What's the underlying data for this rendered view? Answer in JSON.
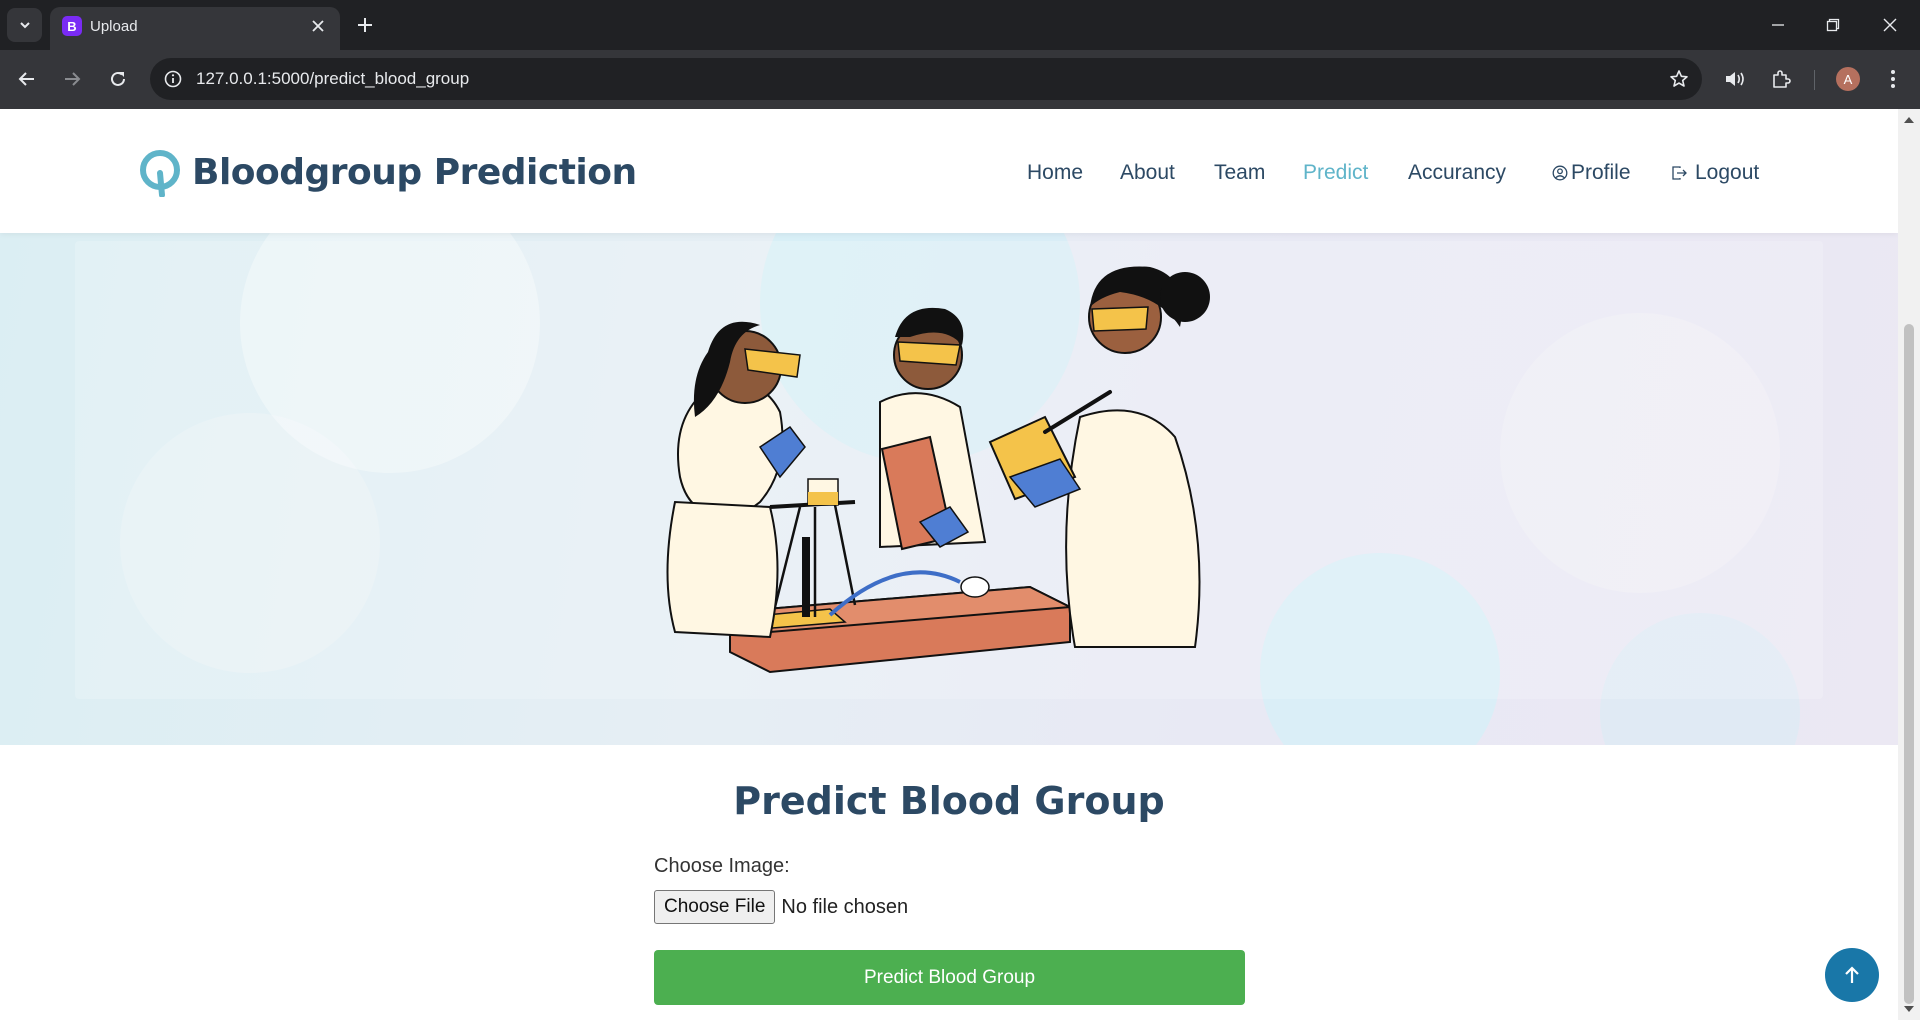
{
  "browser": {
    "tab_title": "Upload",
    "tab_favicon_letter": "B",
    "url": "127.0.0.1:5000/predict_blood_group",
    "profile_initial": "A"
  },
  "site": {
    "brand": "Bloodgroup Prediction",
    "nav": [
      {
        "label": "Home",
        "active": false
      },
      {
        "label": "About",
        "active": false
      },
      {
        "label": "Team",
        "active": false
      },
      {
        "label": "Predict",
        "active": true
      },
      {
        "label": "Accurancy",
        "active": false
      },
      {
        "label": "Profile",
        "active": false,
        "icon": "person-circle-icon"
      },
      {
        "label": "Logout",
        "active": false,
        "icon": "logout-icon"
      }
    ],
    "accent_color": "#5fb4c9",
    "heading_color": "#2c4964"
  },
  "hero": {
    "illustration": "three scientists in lab coats working at a lab bench"
  },
  "form": {
    "title": "Predict Blood Group",
    "image_label": "Choose Image:",
    "file_button": "Choose File",
    "file_status": "No file chosen",
    "submit_label": "Predict Blood Group",
    "submit_color": "#4caf50"
  },
  "back_to_top_color": "#1977a8"
}
